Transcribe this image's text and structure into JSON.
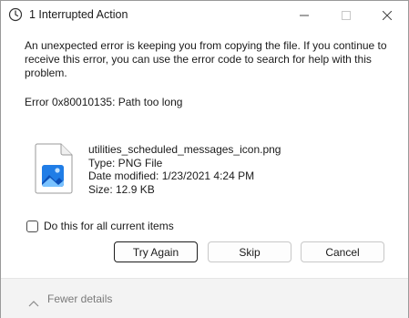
{
  "window": {
    "title": "1 Interrupted Action"
  },
  "dialog": {
    "message": "An unexpected error is keeping you from copying the file. If you continue to receive this error, you can use the error code to search for help with this problem.",
    "error_code": "Error 0x80010135: Path too long",
    "file": {
      "name": "utilities_scheduled_messages_icon.png",
      "type": "Type: PNG File",
      "date_modified": "Date modified: 1/23/2021 4:24 PM",
      "size": "Size: 12.9 KB",
      "icon": "image-file-icon"
    },
    "checkbox": {
      "label": "Do this for all current items",
      "checked": false
    },
    "buttons": {
      "try_again": "Try Again",
      "skip": "Skip",
      "cancel": "Cancel"
    }
  },
  "footer": {
    "toggle_label": "Fewer details"
  },
  "colors": {
    "accent_blue": "#0a64d6",
    "footer_bg": "#f3f3f3"
  }
}
